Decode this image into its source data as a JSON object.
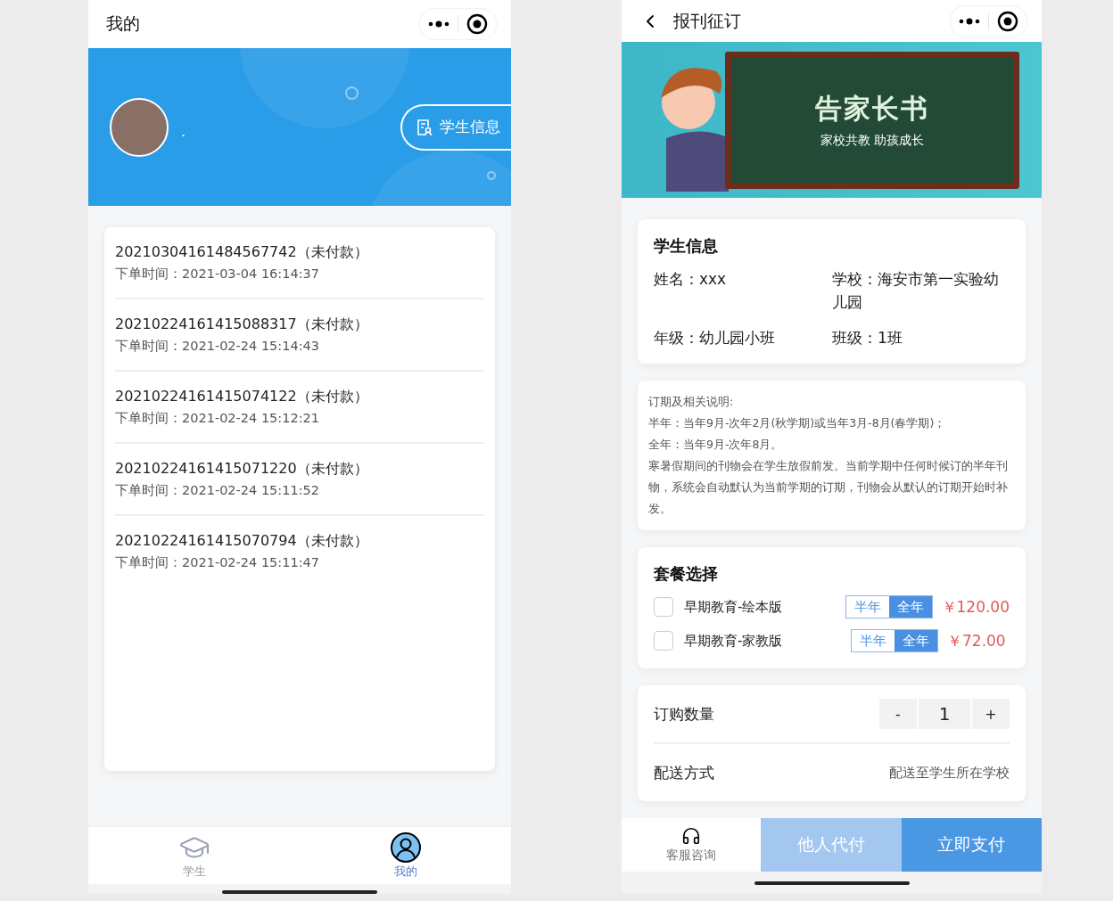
{
  "left": {
    "title": "我的",
    "profile": {
      "name": ".",
      "button": "学生信息"
    },
    "orders": [
      {
        "number": "20210304161484567742（未付款）",
        "time": "下单时间：2021-03-04 16:14:37"
      },
      {
        "number": "20210224161415088317（未付款）",
        "time": "下单时间：2021-02-24 15:14:43"
      },
      {
        "number": "20210224161415074122（未付款）",
        "time": "下单时间：2021-02-24 15:12:21"
      },
      {
        "number": "20210224161415071220（未付款）",
        "time": "下单时间：2021-02-24 15:11:52"
      },
      {
        "number": "20210224161415070794（未付款）",
        "time": "下单时间：2021-02-24 15:11:47"
      }
    ],
    "tabbar": [
      {
        "label": "学生",
        "kind": "student",
        "selected": false
      },
      {
        "label": "我的",
        "kind": "profile",
        "selected": true
      }
    ]
  },
  "right": {
    "title": "报刊征订",
    "banner": {
      "title": "告家长书",
      "subtitle": "家校共教 助孩成长"
    },
    "student": {
      "heading": "学生信息",
      "fields": [
        {
          "label": "姓名：",
          "value": "xxx"
        },
        {
          "label": "学校：",
          "value": "海安市第一实验幼儿园"
        },
        {
          "label": "年级：",
          "value": "幼儿园小班"
        },
        {
          "label": "班级：",
          "value": "1班"
        }
      ]
    },
    "notes": [
      "订期及相关说明:",
      "半年：当年9月-次年2月(秋学期)或当年3月-8月(春学期)；",
      "全年：当年9月-次年8月。",
      "寒暑假期间的刊物会在学生放假前发。当前学期中任何时候订的半年刊物，系统会自动默认为当前学期的订期，刊物会从默认的订期开始时补发。"
    ],
    "packages": {
      "heading": "套餐选择",
      "items": [
        {
          "name": "早期教育-绘本版",
          "checked": false,
          "periods": [
            {
              "label": "半年",
              "selected": false
            },
            {
              "label": "全年",
              "selected": true
            }
          ],
          "price": "￥120.00"
        },
        {
          "name": "早期教育-家教版",
          "checked": false,
          "periods": [
            {
              "label": "半年",
              "selected": false
            },
            {
              "label": "全年",
              "selected": true
            }
          ],
          "price": "￥72.00"
        }
      ]
    },
    "quantity": {
      "label": "订购数量",
      "minus": "-",
      "value": "1",
      "plus": "+"
    },
    "delivery": {
      "label": "配送方式",
      "value": "配送至学生所在学校"
    },
    "footer": {
      "service": "客服咨询",
      "buttons": [
        {
          "label": "他人代付",
          "kind": "secondary"
        },
        {
          "label": "立即支付",
          "kind": "primary"
        }
      ]
    }
  }
}
